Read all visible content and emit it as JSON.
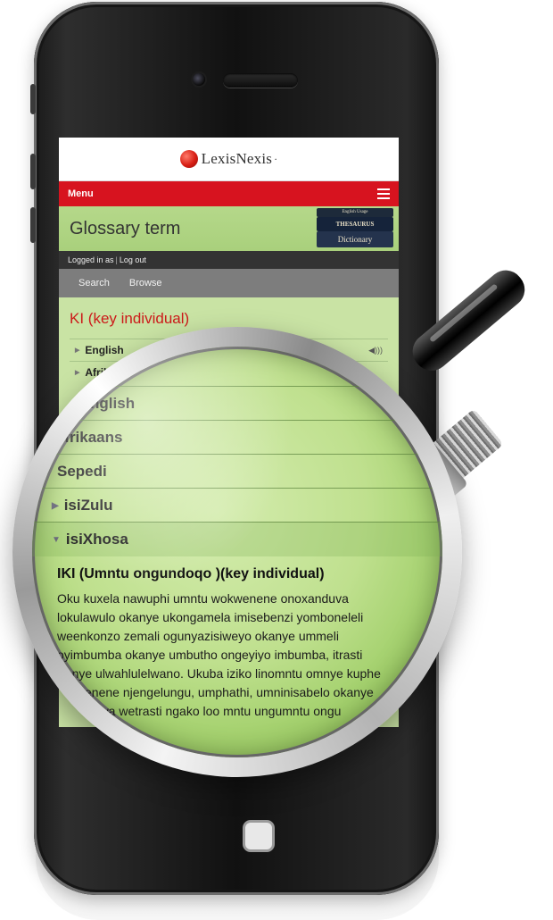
{
  "logo": {
    "text": "LexisNexis",
    "mark": "·"
  },
  "menu": {
    "label": "Menu",
    "hamburger_icon": "hamburger-menu-icon"
  },
  "title_bar": {
    "title": "Glossary term",
    "books": [
      "English Usage",
      "THESAURUS",
      "Dictionary"
    ]
  },
  "login": {
    "logged_in": "Logged in as",
    "separator": "|",
    "logout": "Log out"
  },
  "nav": {
    "tabs": [
      "Search",
      "Browse"
    ]
  },
  "term": {
    "title": "KI (key individual)"
  },
  "languages_small": [
    {
      "label": "English",
      "audio_icon": "speaker-icon"
    },
    {
      "label": "Afrikaans"
    }
  ],
  "magnified": {
    "rows": [
      "English",
      "Afrikaans",
      "Sepedi",
      "isiZulu",
      "isiXhosa"
    ],
    "definition_title": "IKI (Umntu ongundoqo )(key individual)",
    "definition_lines": [
      "Oku kuxela nawuphi umntu wokwenene onoxanduva",
      "lokulawulo okanye ukongamela imisebenzi yomboneleli",
      "weenkonzo zemali ogunyazisiweyo okanye ummeli",
      "oyimbumba okanye umbutho ongeyiyo imbumba, itrasti",
      "okanye ulwahlulelwano.  Ukuba iziko linomntu omnye kuphe",
      "wokwenene njengelungu, umphathi, umninisabelo okanye",
      "athiswa wetrasti ngako loo mntu ungumntu ongu"
    ]
  },
  "colors": {
    "brand_red": "#d7131f",
    "term_red": "#cc1a1a",
    "screen_green": "#c9e3a4"
  }
}
